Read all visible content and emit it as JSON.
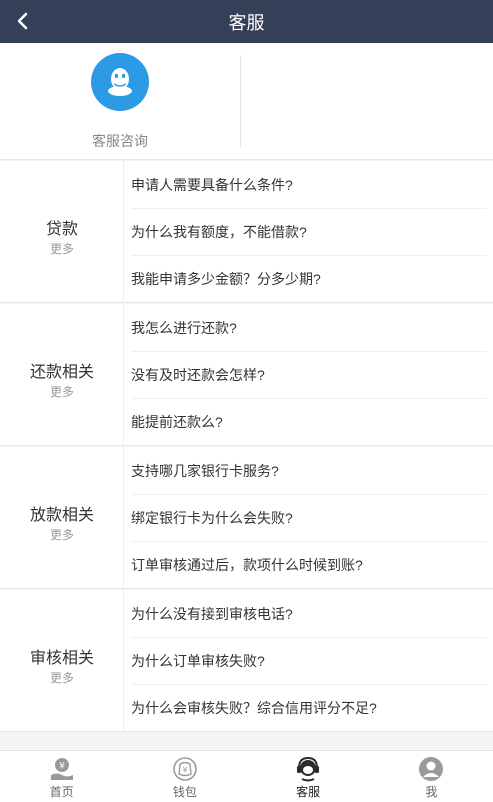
{
  "header": {
    "title": "客服"
  },
  "contact": {
    "label": "客服咨询"
  },
  "sections": [
    {
      "name": "贷款",
      "more": "更多",
      "questions": [
        "申请人需要具备什么条件?",
        "为什么我有额度，不能借款?",
        "我能申请多少金额？分多少期?"
      ]
    },
    {
      "name": "还款相关",
      "more": "更多",
      "questions": [
        "我怎么进行还款?",
        "没有及时还款会怎样?",
        "能提前还款么?"
      ]
    },
    {
      "name": "放款相关",
      "more": "更多",
      "questions": [
        "支持哪几家银行卡服务?",
        "绑定银行卡为什么会失败?",
        "订单审核通过后，款项什么时候到账?"
      ]
    },
    {
      "name": "审核相关",
      "more": "更多",
      "questions": [
        "为什么没有接到审核电话?",
        "为什么订单审核失败?",
        "为什么会审核失败？综合信用评分不足?"
      ]
    }
  ],
  "tabbar": {
    "items": [
      {
        "label": "首页",
        "icon": "home-money-icon"
      },
      {
        "label": "钱包",
        "icon": "wallet-icon"
      },
      {
        "label": "客服",
        "icon": "customer-service-icon"
      },
      {
        "label": "我",
        "icon": "user-icon"
      }
    ],
    "active": "客服"
  },
  "colors": {
    "header_bg": "#343f58",
    "avatar_bg": "#2d9ae6",
    "page_bg": "#f4f4f6"
  }
}
